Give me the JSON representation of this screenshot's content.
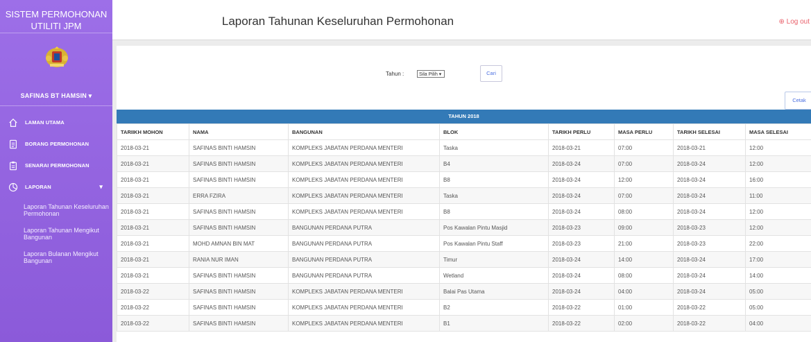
{
  "sidebar": {
    "title": "SISTEM PERMOHONAN UTILITI JPM",
    "user": "SAFINAS BT HAMSIN ▾",
    "nav": [
      {
        "label": "LAMAN UTAMA"
      },
      {
        "label": "BORANG PERMOHONAN"
      },
      {
        "label": "SENARAI PERMOHONAN"
      },
      {
        "label": "LAPORAN"
      }
    ],
    "subnav": [
      "Laporan Tahunan Keseluruhan Permohonan",
      "Laporan Tahunan Mengikut Bangunan",
      "Laporan Bulanan Mengikut Bangunan"
    ]
  },
  "header": {
    "title": "Laporan Tahunan Keseluruhan Permohonan",
    "logout": "⊕ Log out"
  },
  "filter": {
    "label": "Tahun :",
    "select_value": "Sila Pilih ▾",
    "search_button": "Cari"
  },
  "print_button": "Cetak",
  "year_label": "TAHUN 2018",
  "table": {
    "headers": [
      "TARIIKH MOHON",
      "NAMA",
      "BANGUNAN",
      "BLOK",
      "TARIKH PERLU",
      "MASA PERLU",
      "TARIKH SELESAI",
      "MASA SELESAI"
    ],
    "rows": [
      [
        "2018-03-21",
        "SAFINAS BINTI HAMSIN",
        "KOMPLEKS JABATAN PERDANA MENTERI",
        "Taska",
        "2018-03-21",
        "07:00",
        "2018-03-21",
        "12:00"
      ],
      [
        "2018-03-21",
        "SAFINAS BINTI HAMSIN",
        "KOMPLEKS JABATAN PERDANA MENTERI",
        "B4",
        "2018-03-24",
        "07:00",
        "2018-03-24",
        "12:00"
      ],
      [
        "2018-03-21",
        "SAFINAS BINTI HAMSIN",
        "KOMPLEKS JABATAN PERDANA MENTERI",
        "B8",
        "2018-03-24",
        "12:00",
        "2018-03-24",
        "16:00"
      ],
      [
        "2018-03-21",
        "ERRA FZIRA",
        "KOMPLEKS JABATAN PERDANA MENTERI",
        "Taska",
        "2018-03-24",
        "07:00",
        "2018-03-24",
        "11:00"
      ],
      [
        "2018-03-21",
        "SAFINAS BINTI HAMSIN",
        "KOMPLEKS JABATAN PERDANA MENTERI",
        "B8",
        "2018-03-24",
        "08:00",
        "2018-03-24",
        "12:00"
      ],
      [
        "2018-03-21",
        "SAFINAS BINTI HAMSIN",
        "BANGUNAN PERDANA PUTRA",
        "Pos Kawalan Pintu Masjid",
        "2018-03-23",
        "09:00",
        "2018-03-23",
        "12:00"
      ],
      [
        "2018-03-21",
        "MOHD AMNAN BIN MAT",
        "BANGUNAN PERDANA PUTRA",
        "Pos Kawalan Pintu Staff",
        "2018-03-23",
        "21:00",
        "2018-03-23",
        "22:00"
      ],
      [
        "2018-03-21",
        "RANIA NUR IMAN",
        "BANGUNAN PERDANA PUTRA",
        "Timur",
        "2018-03-24",
        "14:00",
        "2018-03-24",
        "17:00"
      ],
      [
        "2018-03-21",
        "SAFINAS BINTI HAMSIN",
        "BANGUNAN PERDANA PUTRA",
        "Wetland",
        "2018-03-24",
        "08:00",
        "2018-03-24",
        "14:00"
      ],
      [
        "2018-03-22",
        "SAFINAS BINTI HAMSIN",
        "KOMPLEKS JABATAN PERDANA MENTERI",
        "Balai Pas Utama",
        "2018-03-24",
        "04:00",
        "2018-03-24",
        "05:00"
      ],
      [
        "2018-03-22",
        "SAFINAS BINTI HAMSIN",
        "KOMPLEKS JABATAN PERDANA MENTERI",
        "B2",
        "2018-03-22",
        "01:00",
        "2018-03-22",
        "05:00"
      ],
      [
        "2018-03-22",
        "SAFINAS BINTI HAMSIN",
        "KOMPLEKS JABATAN PERDANA MENTERI",
        "B1",
        "2018-03-22",
        "02:00",
        "2018-03-22",
        "04:00"
      ]
    ]
  }
}
